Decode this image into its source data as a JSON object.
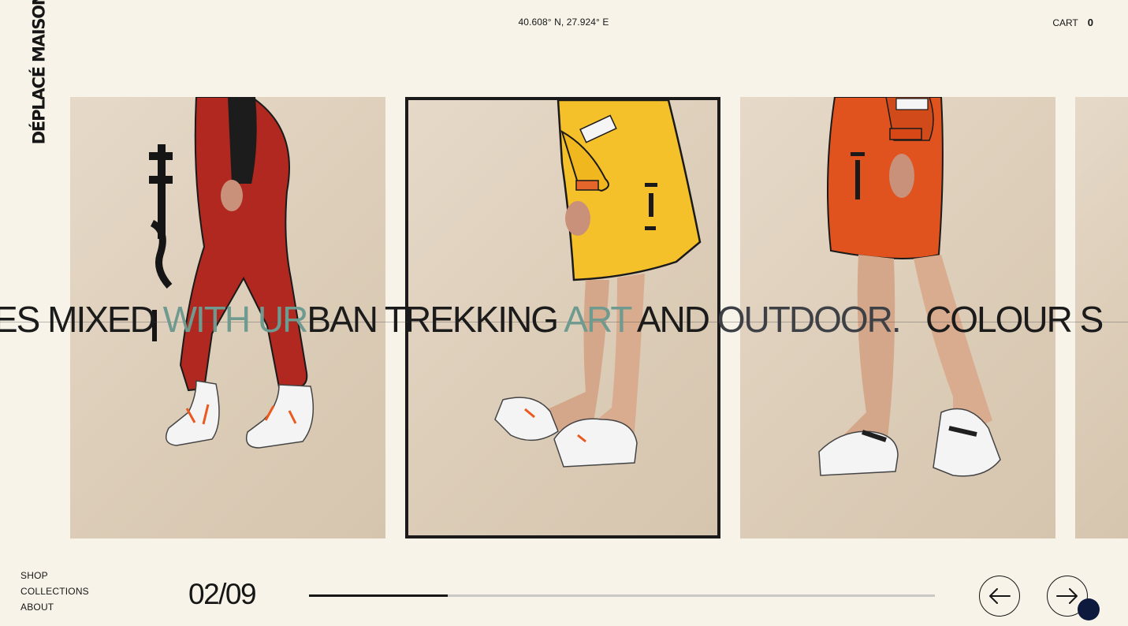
{
  "brand": {
    "logo_text": "DÉPLACÉ MAISON"
  },
  "header": {
    "coordinates": "40.608° N, 27.924° E",
    "cart_label": "CART",
    "cart_count": "0"
  },
  "marquee": {
    "part1": "ES MIXED ",
    "part2": "WITH UR",
    "part3": "BAN TREKKING ",
    "part4": "ART",
    "part5": " AND ",
    "part6": "OUTDOOR.",
    "part7": "   COLOUR S"
  },
  "nav": {
    "items": [
      "SHOP",
      "COLLECTIONS",
      "ABOUT"
    ]
  },
  "slider": {
    "counter": "02/09",
    "current": 2,
    "total": 9,
    "progress": 0.222
  },
  "icons": {
    "prev": "arrow-left-icon",
    "next": "arrow-right-icon"
  },
  "colors": {
    "background": "#f7f3e8",
    "card": "#e1d4c1",
    "active_border": "#1a1a1a",
    "accent_text": "#6f9a8f",
    "red": "#b0281f",
    "yellow": "#f4c12b",
    "orange": "#e0531f",
    "cursor": "#0e1a3d"
  }
}
